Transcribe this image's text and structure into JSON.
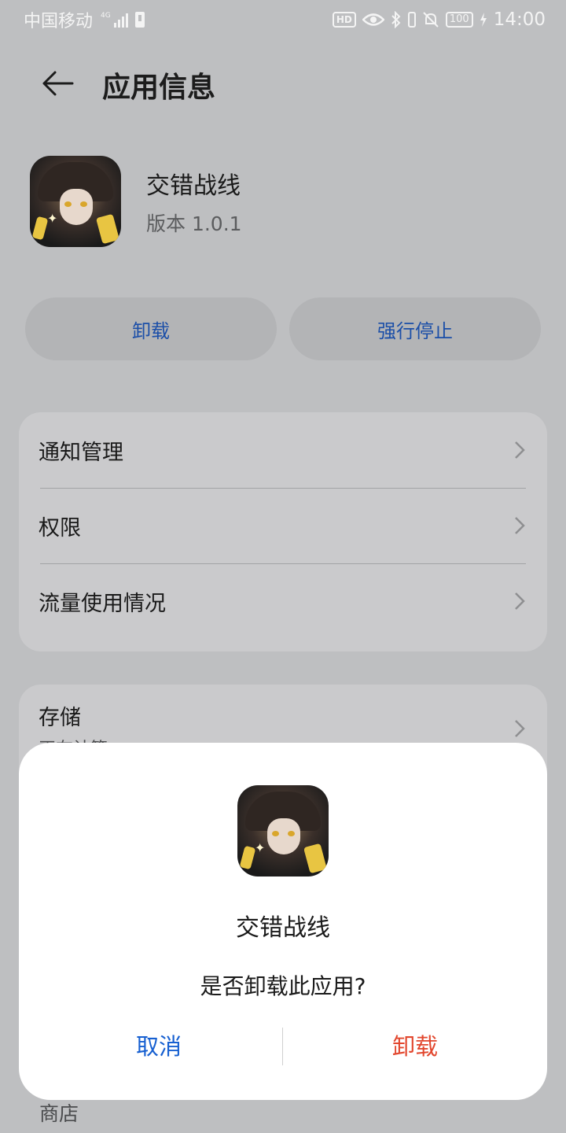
{
  "status_bar": {
    "carrier": "中国移动",
    "signal_label": "4G",
    "hd": "HD",
    "battery": "100",
    "time": "14:00"
  },
  "header": {
    "title": "应用信息"
  },
  "app": {
    "name": "交错战线",
    "version": "版本 1.0.1"
  },
  "actions": {
    "uninstall": "卸载",
    "force_stop": "强行停止"
  },
  "settings": {
    "items": [
      {
        "label": "通知管理"
      },
      {
        "label": "权限"
      },
      {
        "label": "流量使用情况"
      }
    ]
  },
  "storage": {
    "title": "存储",
    "subtitle": "正在计算"
  },
  "store_label": "商店",
  "dialog": {
    "app_name": "交错战线",
    "message": "是否卸载此应用?",
    "cancel": "取消",
    "confirm": "卸载"
  },
  "colors": {
    "accent_blue": "#1760d1",
    "danger_red": "#e2462d",
    "scrim_bg": "#bebfc1"
  }
}
